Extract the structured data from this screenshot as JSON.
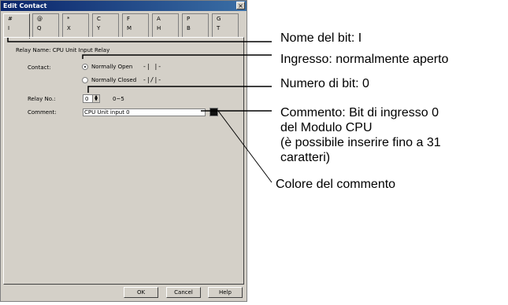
{
  "dialog": {
    "title": "Edit Contact",
    "close_glyph": "×",
    "tabs": [
      {
        "top": "#",
        "bottom": "I"
      },
      {
        "top": "@",
        "bottom": "Q"
      },
      {
        "top": "*",
        "bottom": "X"
      },
      {
        "top": "C",
        "bottom": "Y"
      },
      {
        "top": "F",
        "bottom": "M"
      },
      {
        "top": "A",
        "bottom": "H"
      },
      {
        "top": "P",
        "bottom": "B"
      },
      {
        "top": "G",
        "bottom": "T"
      }
    ],
    "relay_name": "Relay Name:  CPU Unit Input Relay",
    "contact_label": "Contact:",
    "normally_open": "Normally Open",
    "normally_closed": "Normally Closed",
    "open_symbol": "-| |-",
    "closed_symbol": "-|/|-",
    "relay_no_label": "Relay No.:",
    "relay_no_value": "0",
    "relay_range": "0~5",
    "comment_label": "Comment:",
    "comment_value": "CPU Unit input 0",
    "comment_color": "#111111",
    "buttons": {
      "ok": "OK",
      "cancel": "Cancel",
      "help": "Help"
    }
  },
  "annotations": {
    "bit_name": "Nome del bit: I",
    "input_type": "Ingresso: normalmente aperto",
    "bit_number": "Numero di bit: 0",
    "comment_1": "Commento: Bit di ingresso 0",
    "comment_2": "del Modulo CPU",
    "comment_3": "(è possibile inserire fino a 31",
    "comment_4": "caratteri)",
    "comment_color": "Colore del commento"
  }
}
